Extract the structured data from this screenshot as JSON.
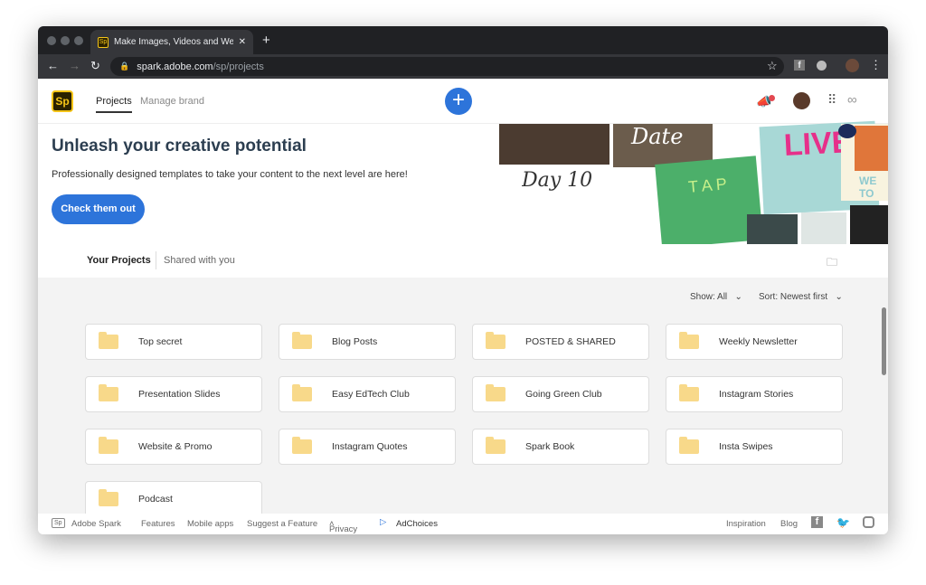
{
  "browser": {
    "tab_title": "Make Images, Videos and Web S",
    "url_domain": "spark.adobe.com",
    "url_path": "/sp/projects",
    "favicon": "Sp"
  },
  "header": {
    "logo": "Sp",
    "nav": [
      "Projects",
      "Manage brand"
    ],
    "accent": "#2d74da"
  },
  "banner": {
    "title": "Unleash your creative potential",
    "subtitle": "Professionally designed templates to take your content to the next level are here!",
    "cta": "Check them out",
    "art": {
      "day": "Day 10",
      "live": "LIVE",
      "date": "Date",
      "tap": "T A P",
      "wel": "WE TO TH"
    }
  },
  "project_tabs": [
    "Your Projects",
    "Shared with you"
  ],
  "filters": {
    "show": "Show: All",
    "sort": "Sort: Newest first"
  },
  "folders": [
    "Top secret",
    "Blog Posts",
    "POSTED & SHARED",
    "Weekly Newsletter",
    "Presentation Slides",
    "Easy EdTech Club",
    "Going Green Club",
    "Instagram Stories",
    "Website & Promo",
    "Instagram Quotes",
    "Spark Book",
    "Insta Swipes",
    "Podcast"
  ],
  "footer": {
    "logo": "Sp",
    "left": [
      "Adobe Spark",
      "Features",
      "Mobile apps",
      "Suggest a Feature",
      "Privacy",
      "AdChoices"
    ],
    "right": [
      "Inspiration",
      "Blog"
    ]
  }
}
